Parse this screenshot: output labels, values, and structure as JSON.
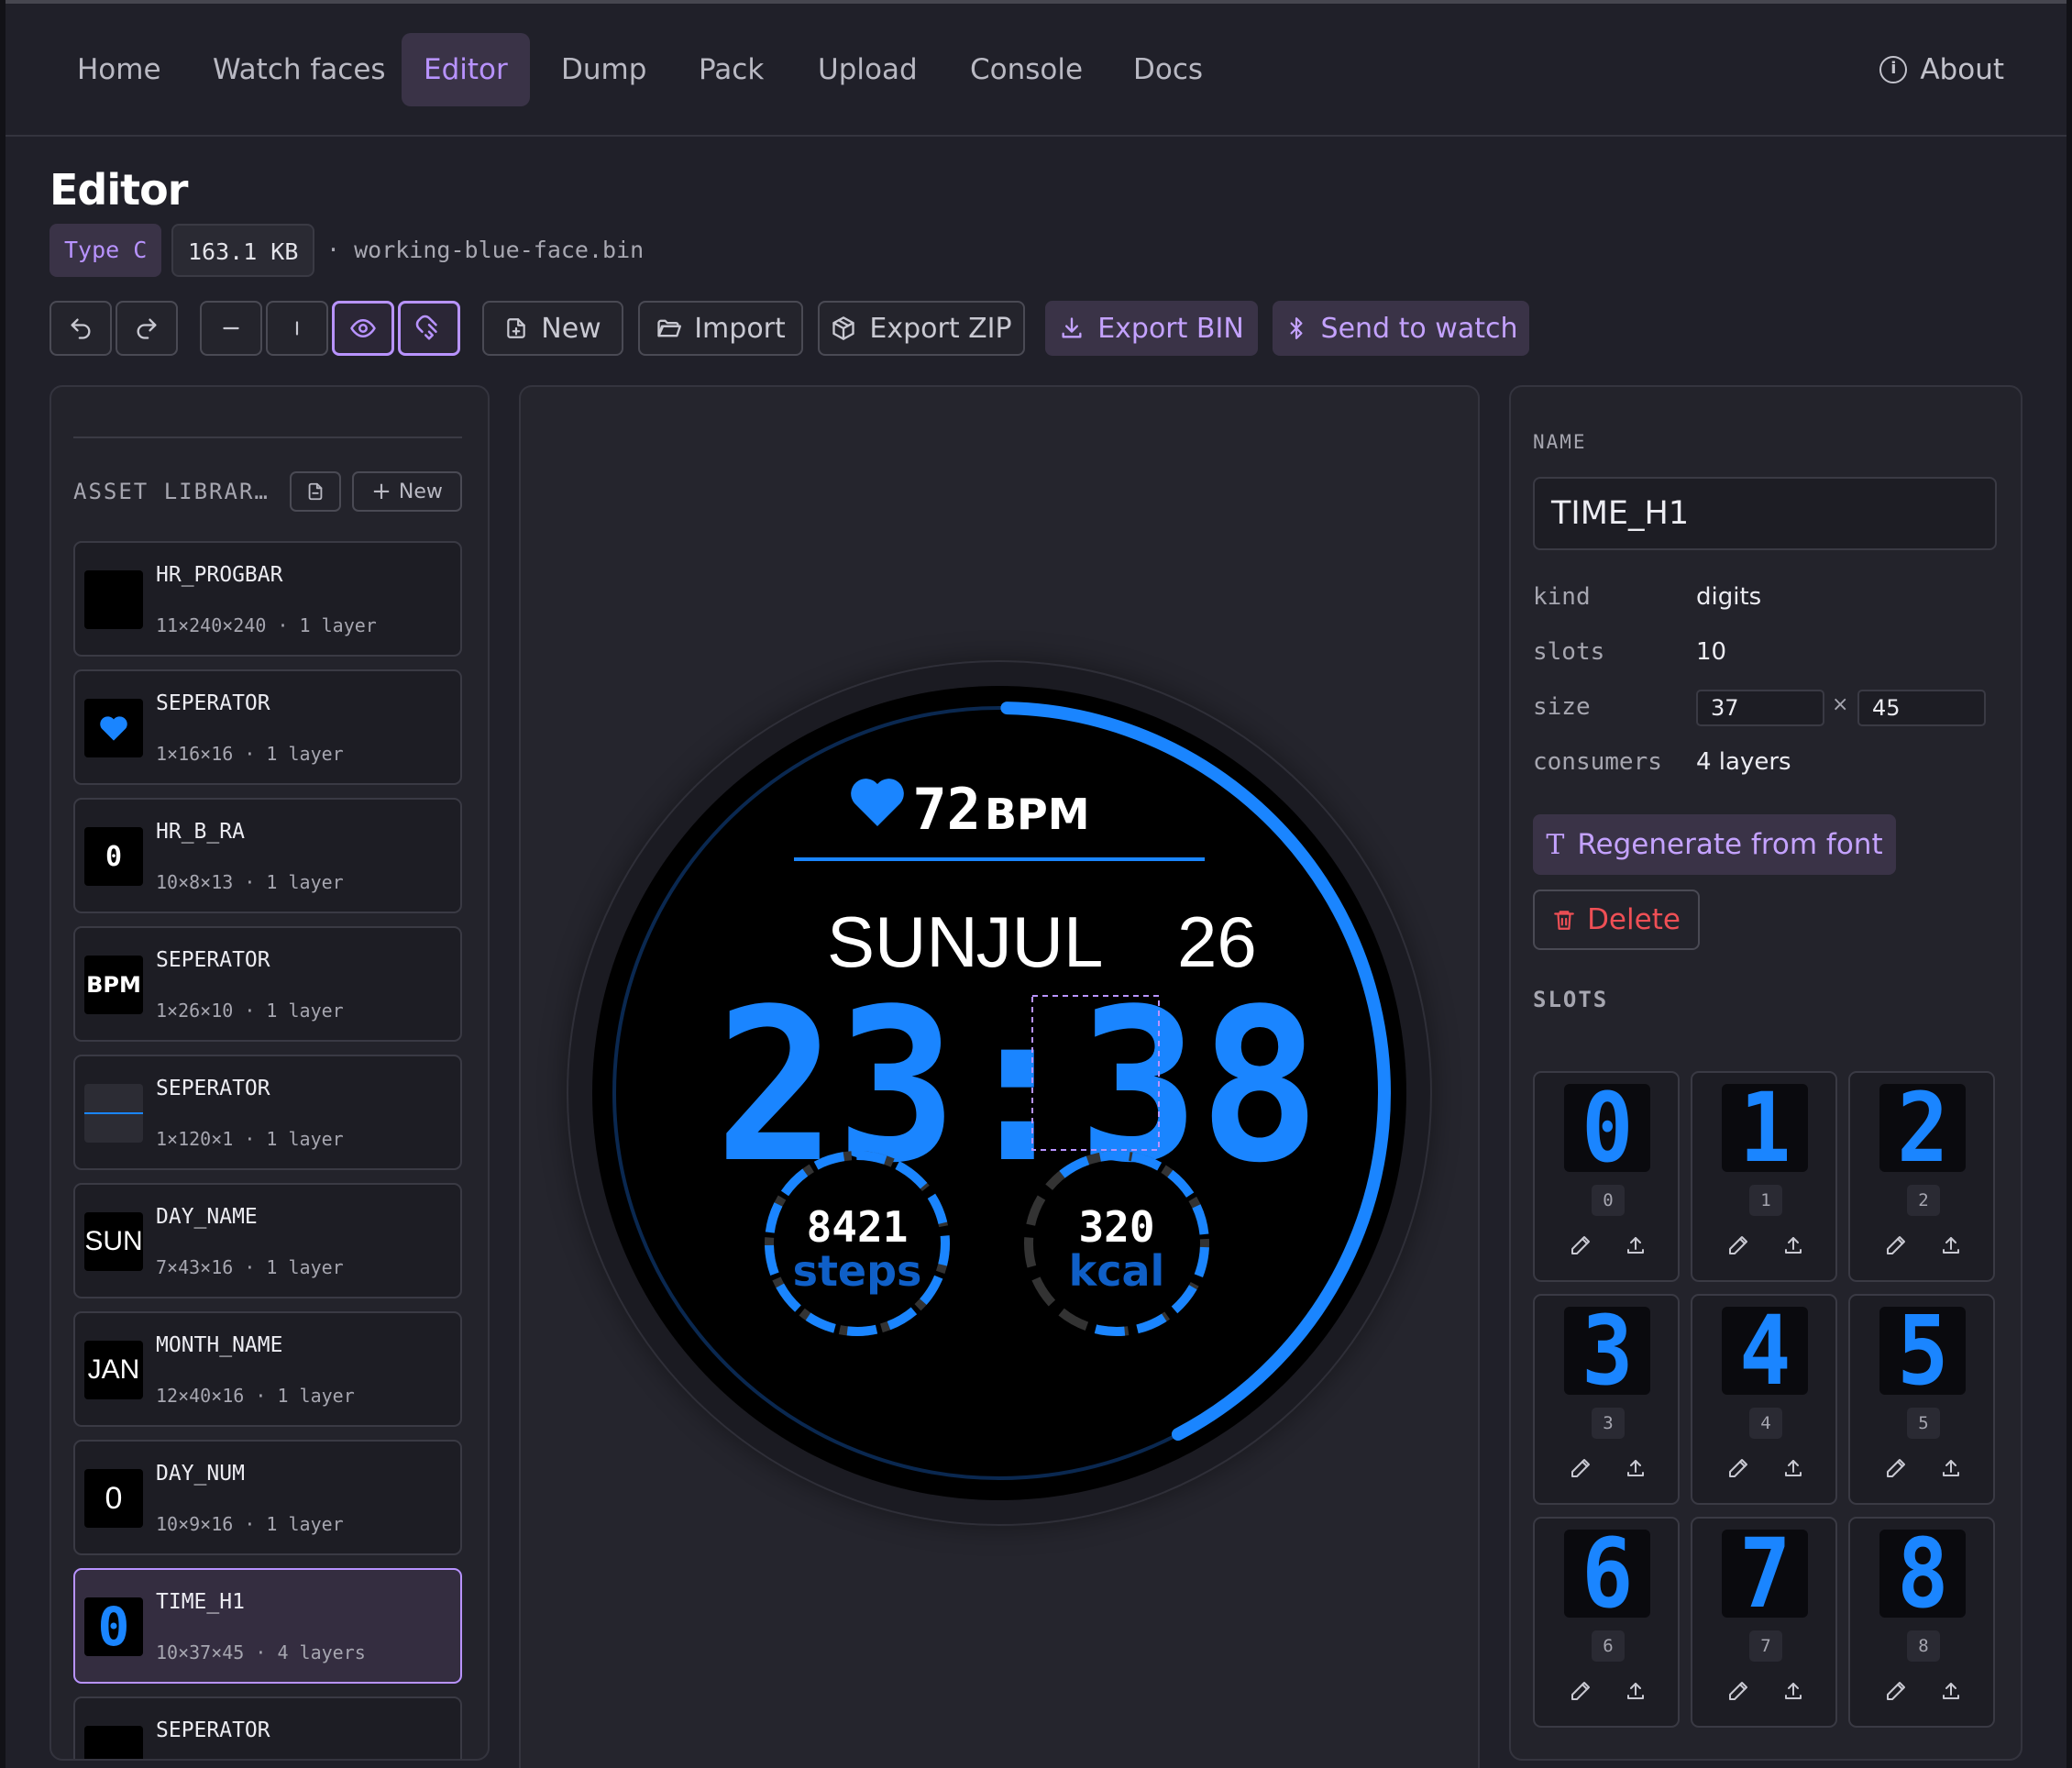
{
  "nav": {
    "items": [
      "Home",
      "Watch faces",
      "Editor",
      "Dump",
      "Pack",
      "Upload",
      "Console",
      "Docs"
    ],
    "active": "Editor",
    "about": "About"
  },
  "header": {
    "title": "Editor",
    "type_chip": "Type C",
    "size_chip": "163.1 KB",
    "filename": "· working-blue-face.bin"
  },
  "toolbar": {
    "new_label": "New",
    "import_label": "Import",
    "export_zip_label": "Export ZIP",
    "export_bin_label": "Export BIN",
    "send_label": "Send to watch"
  },
  "library": {
    "title": "ASSET LIBRAR…",
    "new_label": "New",
    "assets": [
      {
        "name": "HR_PROGBAR",
        "meta": "11×240×240 · 1 layer",
        "thumb": "dark"
      },
      {
        "name": "SEPERATOR",
        "meta": "1×16×16 · 1 layer",
        "thumb": "heart"
      },
      {
        "name": "HR_B_RA",
        "meta": "10×8×13 · 1 layer",
        "thumb": "0"
      },
      {
        "name": "SEPERATOR",
        "meta": "1×26×10 · 1 layer",
        "thumb": "BPM"
      },
      {
        "name": "SEPERATOR",
        "meta": "1×120×1 · 1 layer",
        "thumb": "line"
      },
      {
        "name": "DAY_NAME",
        "meta": "7×43×16 · 1 layer",
        "thumb": "SUN"
      },
      {
        "name": "MONTH_NAME",
        "meta": "12×40×16 · 1 layer",
        "thumb": "JAN"
      },
      {
        "name": "DAY_NUM",
        "meta": "10×9×16 · 1 layer",
        "thumb": "0"
      },
      {
        "name": "TIME_H1",
        "meta": "10×37×45 · 4 layers",
        "thumb": "0"
      },
      {
        "name": "SEPERATOR",
        "meta": "",
        "thumb": "dark"
      }
    ]
  },
  "watch": {
    "bpm_value": "72",
    "bpm_unit": "BPM",
    "day": "SUN",
    "month": "JUL",
    "date": "26",
    "time": "23:38",
    "steps_value": "8421",
    "steps_label": "steps",
    "kcal_value": "320",
    "kcal_label": "kcal",
    "hr_progress": 0.42,
    "accent": "#1a85ff"
  },
  "inspector": {
    "name_label": "NAME",
    "name_value": "TIME_H1",
    "kind_key": "kind",
    "kind_value": "digits",
    "slots_key": "slots",
    "slots_value": "10",
    "size_key": "size",
    "size_w": "37",
    "size_x": "×",
    "size_h": "45",
    "consumers_key": "consumers",
    "consumers_value": "4 layers",
    "regen_label": "Regenerate from font",
    "delete_label": "Delete",
    "slots_title": "SLOTS",
    "slots": [
      "0",
      "1",
      "2",
      "3",
      "4",
      "5",
      "6",
      "7",
      "8"
    ]
  },
  "colors": {
    "accent_purple": "#b893ff",
    "danger": "#ef4f55",
    "watch_blue": "#1a85ff"
  }
}
